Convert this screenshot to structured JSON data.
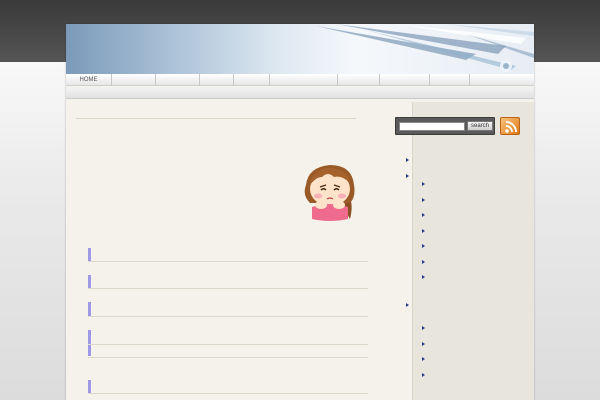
{
  "header": {
    "nav_items": [
      "HOME",
      "",
      "",
      "",
      "",
      "",
      "",
      "",
      "",
      ""
    ]
  },
  "search": {
    "value": "",
    "button_label": "search"
  },
  "icons": {
    "feed": "rss-icon",
    "bullet": "triangle-bullet-icon",
    "mascot": "girl-mascot-illustration"
  },
  "colors": {
    "header_band": "#454545",
    "banner_accent": "#7b9ab9",
    "content_bg": "#f4f2ea",
    "sidebar_bg": "#e8e6dc",
    "post_marker": "#9e99e6",
    "bullet": "#2a3d8f",
    "rss": "#e27b1c"
  }
}
